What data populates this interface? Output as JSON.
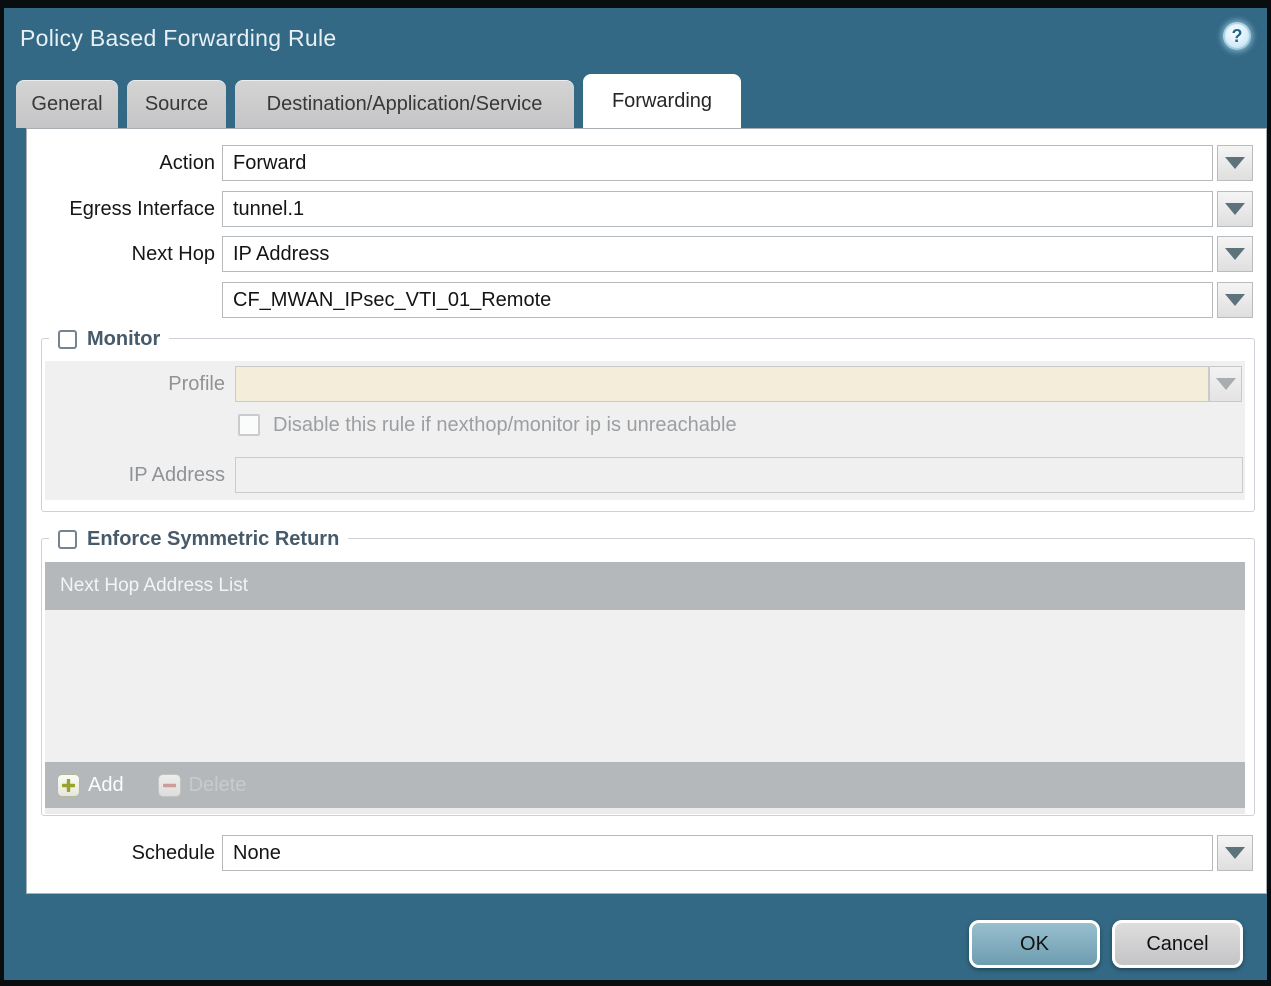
{
  "dialog": {
    "title": "Policy Based Forwarding Rule"
  },
  "icons": {
    "help": "?",
    "dropdown": "triangle-down",
    "add": "plus",
    "delete": "minus"
  },
  "colors": {
    "accent_teal": "#336985",
    "tab_inactive_gray": "#cbcbcc",
    "disabled_field_beige": "#f4edda",
    "panel_gray": "#f0f0f1",
    "grid_chrome_gray": "#b4b8ba",
    "ok_button_blue": "#7fadbf",
    "add_plus_green": "#99a32c",
    "delete_minus_red": "#d09a9a"
  },
  "tabs": [
    {
      "label": "General",
      "active": false
    },
    {
      "label": "Source",
      "active": false
    },
    {
      "label": "Destination/Application/Service",
      "active": false
    },
    {
      "label": "Forwarding",
      "active": true
    }
  ],
  "form": {
    "action": {
      "label": "Action",
      "value": "Forward"
    },
    "egress_interface": {
      "label": "Egress Interface",
      "value": "tunnel.1"
    },
    "next_hop": {
      "label": "Next Hop",
      "value": "IP Address"
    },
    "next_hop_address": {
      "value": "CF_MWAN_IPsec_VTI_01_Remote"
    },
    "schedule": {
      "label": "Schedule",
      "value": "None"
    }
  },
  "monitor": {
    "legend": "Monitor",
    "checked": false,
    "profile": {
      "label": "Profile",
      "value": "",
      "disabled": true
    },
    "disable_rule": {
      "label": "Disable this rule if nexthop/monitor ip is unreachable",
      "checked": false,
      "disabled": true
    },
    "ip_address": {
      "label": "IP Address",
      "value": "",
      "disabled": true
    }
  },
  "enforce_symmetric_return": {
    "legend": "Enforce Symmetric Return",
    "checked": false,
    "table": {
      "header": "Next Hop Address List",
      "rows": []
    },
    "add_label": "Add",
    "delete_label": "Delete",
    "delete_disabled": true
  },
  "footer": {
    "ok": "OK",
    "cancel": "Cancel"
  }
}
